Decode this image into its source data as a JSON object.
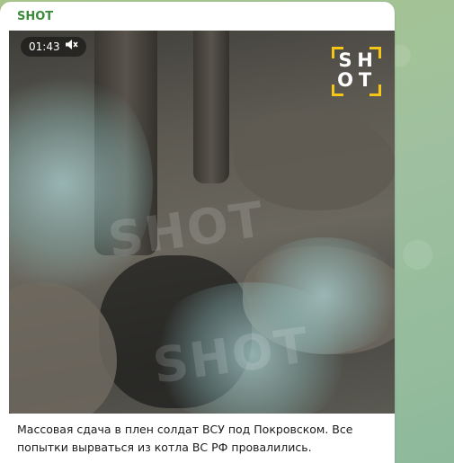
{
  "message": {
    "channel_name": "SHOT",
    "caption": "Массовая сдача в плен солдат ВСУ под Покровском. Все попытки вырваться из котла ВС РФ провалились."
  },
  "video": {
    "duration": "01:43",
    "muted_icon": "speaker-muted-icon",
    "logo_letters": [
      "S",
      "H",
      "O",
      "T"
    ],
    "watermark_text": "SHOT"
  },
  "colors": {
    "channel_name": "#3b8a3c",
    "logo_accent": "#f5c518",
    "chat_background": "#a9c58f"
  }
}
